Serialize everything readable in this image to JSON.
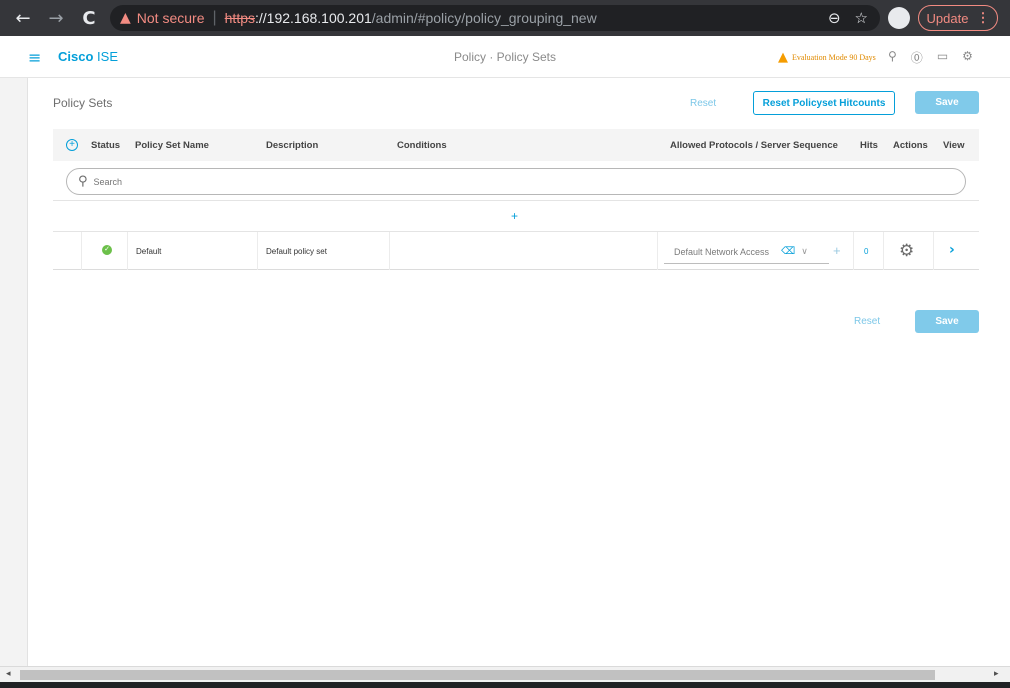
{
  "browser": {
    "back": "←",
    "forward": "→",
    "reload": "C",
    "security_warning": "Not secure",
    "url_scheme": "https",
    "url_host": "://192.168.100.201",
    "url_path": "/admin/#policy/policy_grouping_new",
    "update_label": "Update"
  },
  "header": {
    "brand_cisco": "Cisco",
    "brand_ise": "ISE",
    "title": "Policy · Policy Sets",
    "eval_mode": "Evaluation Mode 90 Days"
  },
  "page": {
    "title": "Policy Sets",
    "reset_label": "Reset",
    "reset_hitcounts_label": "Reset Policyset Hitcounts",
    "save_label": "Save"
  },
  "table": {
    "columns": [
      "Status",
      "Policy Set Name",
      "Description",
      "Conditions",
      "Allowed Protocols / Server Sequence",
      "Hits",
      "Actions",
      "View"
    ],
    "search_placeholder": "Search",
    "add_row_symbol": "+",
    "rows": [
      {
        "status": "enabled",
        "name": "Default",
        "description": "Default policy set",
        "conditions": "",
        "protocol": "Default Network Access",
        "hits": "0"
      }
    ]
  },
  "footer": {
    "reset_label": "Reset",
    "save_label": "Save"
  },
  "colors": {
    "accent": "#049fd9",
    "status_ok": "#6cc04a",
    "warning": "#f59c00"
  }
}
